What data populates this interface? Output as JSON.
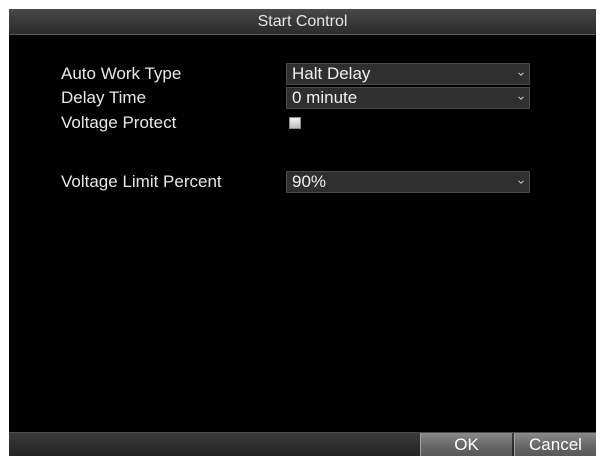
{
  "dialog": {
    "title": "Start Control"
  },
  "form": {
    "auto_work_type": {
      "label": "Auto Work Type",
      "value": "Halt Delay"
    },
    "delay_time": {
      "label": "Delay Time",
      "value": "0 minute"
    },
    "voltage_protect": {
      "label": "Voltage Protect",
      "checked": false
    },
    "voltage_limit_percent": {
      "label": "Voltage Limit Percent",
      "value": "90%"
    }
  },
  "buttons": {
    "ok_label": "OK",
    "cancel_label": "Cancel"
  },
  "icons": {
    "dropdown": "chevron-down-icon"
  },
  "colors": {
    "background": "#000000",
    "field": "#2f2f2f",
    "text": "#e8e8e8",
    "button": "#6a6a6a"
  }
}
